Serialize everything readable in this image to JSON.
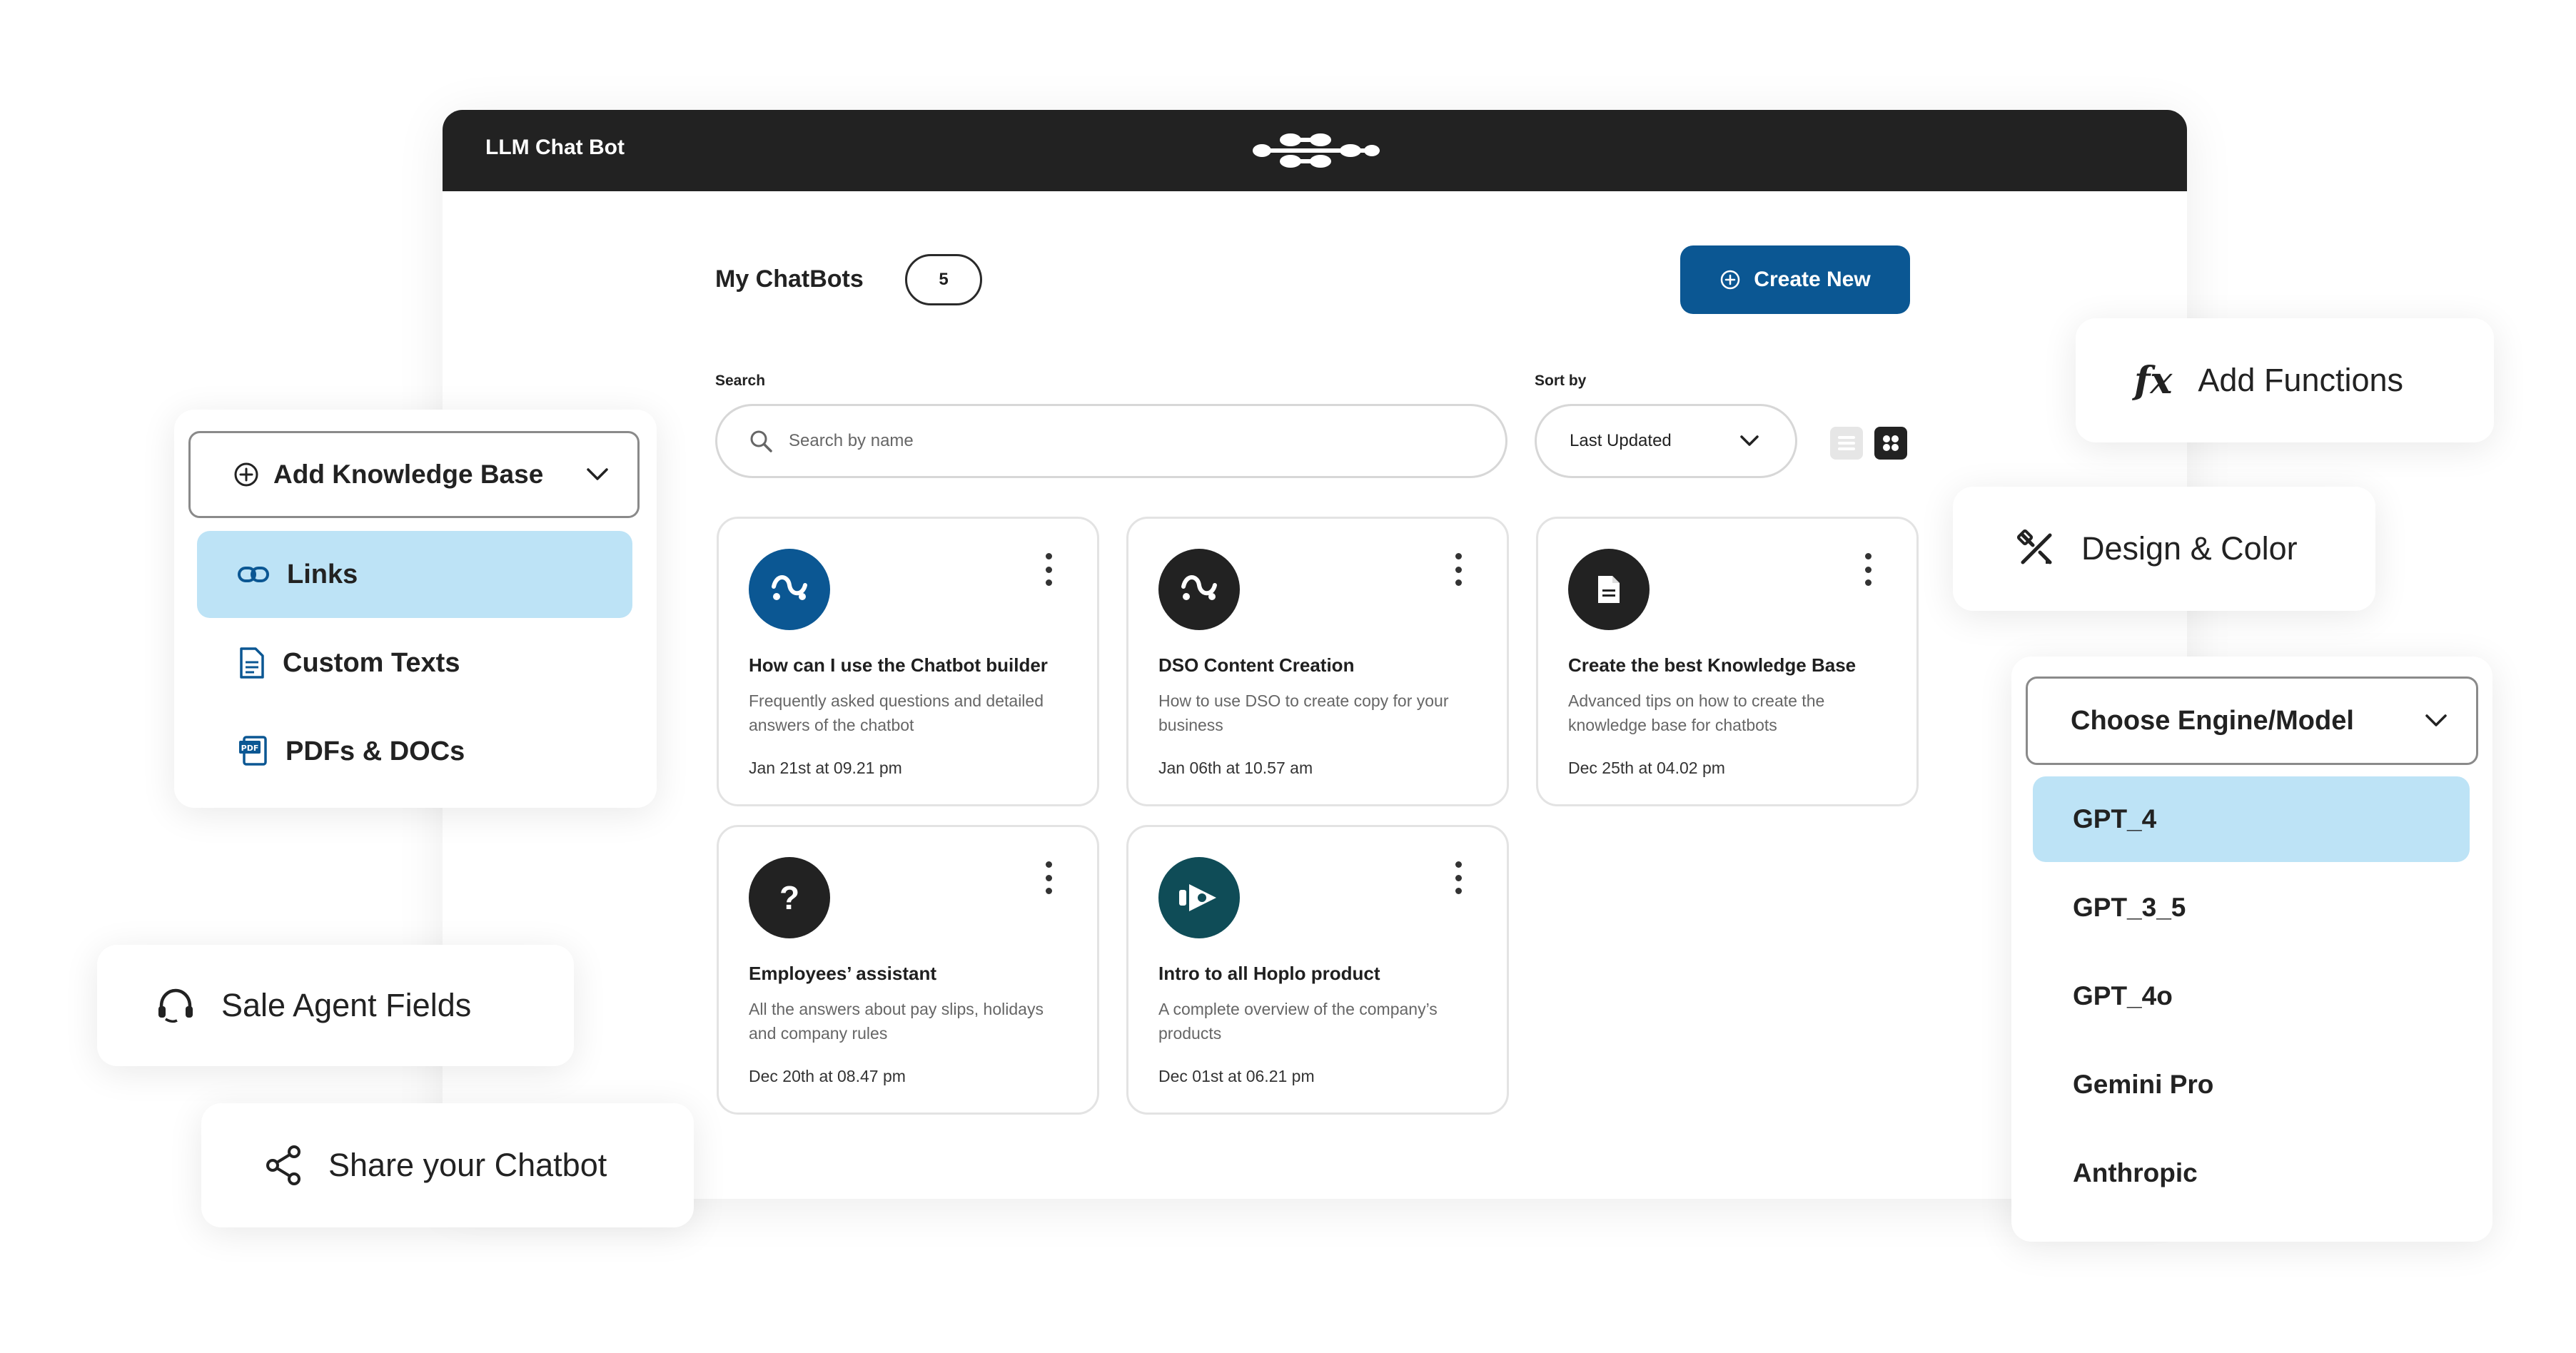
{
  "app": {
    "title": "LLM Chat Bot",
    "heading": "My ChatBots",
    "chatbot_count": "5",
    "create_button": "Create New",
    "search_label": "Search",
    "search_placeholder": "Search by name",
    "sort_label": "Sort by",
    "sort_value": "Last Updated",
    "view_modes": [
      "list",
      "grid"
    ],
    "active_view": "grid"
  },
  "cards": [
    {
      "title": "How can I use the Chatbot builder",
      "desc": "Frequently asked questions and detailed answers of the chatbot",
      "date": "Jan 21st at 09.21 pm",
      "icon": "wave-icon",
      "color": "#0b5793"
    },
    {
      "title": "DSO Content Creation",
      "desc": "How to use DSO to create copy for your business",
      "date": "Jan 06th at 10.57 am",
      "icon": "wave-icon",
      "color": "#222222"
    },
    {
      "title": "Create the best Knowledge Base",
      "desc": "Advanced tips on how to create the knowledge base for chatbots",
      "date": "Dec 25th at 04.02 pm",
      "icon": "document-icon",
      "color": "#222222"
    },
    {
      "title": "Employees’ assistant",
      "desc": "All the answers about pay slips, holidays and company rules",
      "date": "Dec 20th at 08.47 pm",
      "icon": "question-icon",
      "color": "#222222"
    },
    {
      "title": "Intro to all Hoplo product",
      "desc": "A complete overview of the company’s products",
      "date": "Dec 01st at 06.21 pm",
      "icon": "hoplo-icon",
      "color": "#0f4c57"
    }
  ],
  "knowledge_base": {
    "title": "Add Knowledge Base",
    "items": [
      {
        "label": "Links",
        "icon": "link-icon",
        "active": true
      },
      {
        "label": "Custom Texts",
        "icon": "text-document-icon",
        "active": false
      },
      {
        "label": "PDFs & DOCs",
        "icon": "pdf-icon",
        "active": false
      }
    ]
  },
  "features": {
    "add_functions": "Add Functions",
    "design_color": "Design & Color",
    "sale_agent": "Sale Agent Fields",
    "share": "Share your Chatbot"
  },
  "engine": {
    "title": "Choose Engine/Model",
    "options": [
      "GPT_4",
      "GPT_3_5",
      "GPT_4o",
      "Gemini Pro",
      "Anthropic"
    ],
    "selected": "GPT_4"
  },
  "colors": {
    "primary": "#0b5793",
    "highlight": "#bde3f6",
    "titlebar": "#222222"
  }
}
